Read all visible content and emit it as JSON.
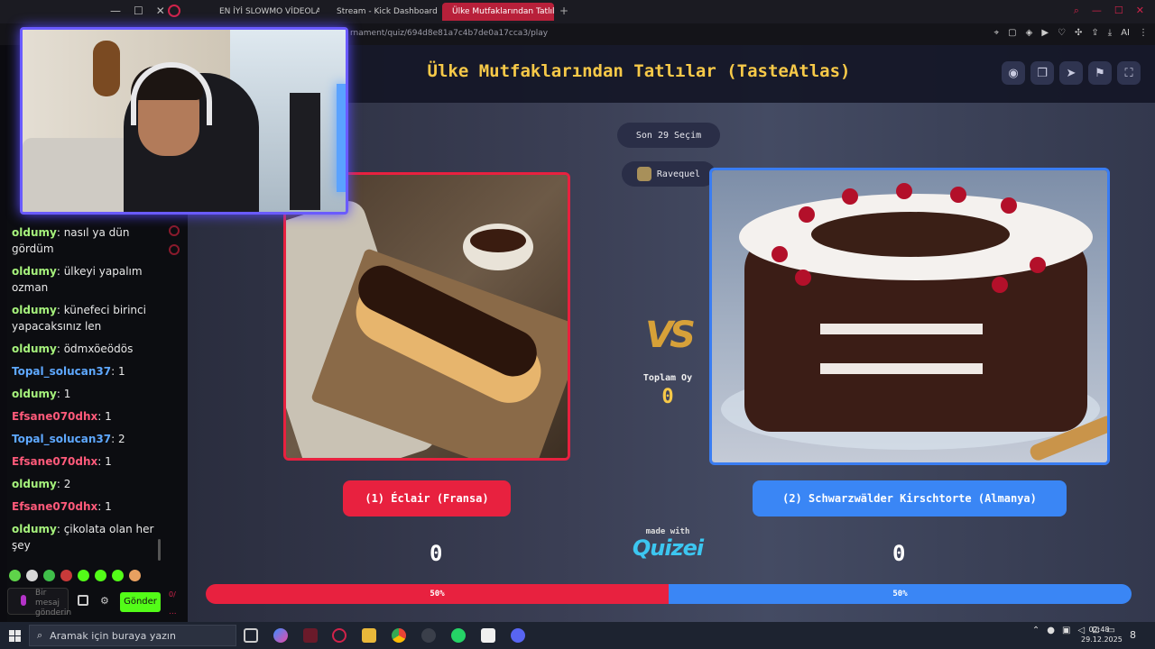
{
  "browser": {
    "tabs": [
      {
        "label": "EN İYİ SLOWMO VİDEOLA",
        "color": "#ff2a2a"
      },
      {
        "label": "Stream - Kick Dashboard",
        "color": "#53fc18"
      },
      {
        "label": "Ülke Mutfaklarından Tatlıla",
        "color": "#e8a33a",
        "active": true
      }
    ],
    "new_tab": "+",
    "url": "rnament/quiz/694d8e81a7c4b7de0a17cca3/play",
    "ai_label": "AI"
  },
  "chat": {
    "messages": [
      {
        "user": "oldumy",
        "text": " nasıl ya dün gördüm",
        "color": "#a6f27c"
      },
      {
        "user": "oldumy",
        "text": " ülkeyi yapalım ozman",
        "color": "#a6f27c"
      },
      {
        "user": "oldumy",
        "text": " künefeci birinci yapacaksınız len",
        "color": "#a6f27c"
      },
      {
        "user": "oldumy",
        "text": " ödmxöeödös",
        "color": "#a6f27c"
      },
      {
        "user": "Topal_solucan37",
        "text": " 1",
        "color": "#5ea8ff"
      },
      {
        "user": "oldumy",
        "text": " 1",
        "color": "#a6f27c"
      },
      {
        "user": "Efsane070dhx",
        "text": " 1",
        "color": "#ff5a7a"
      },
      {
        "user": "Topal_solucan37",
        "text": " 2",
        "color": "#5ea8ff"
      },
      {
        "user": "Efsane070dhx",
        "text": " 1",
        "color": "#ff5a7a"
      },
      {
        "user": "oldumy",
        "text": " 2",
        "color": "#a6f27c"
      },
      {
        "user": "Efsane070dhx",
        "text": " 1",
        "color": "#ff5a7a"
      },
      {
        "user": "oldumy",
        "text": " çikolata olan her şey",
        "color": "#a6f27c"
      }
    ],
    "input_placeholder": "Bir mesaj gönderin",
    "send_label": "Gönder",
    "count": "0/",
    "dots": "..."
  },
  "quiz": {
    "title": "Ülke Mutfaklarından Tatlılar (TasteAtlas)",
    "round_label": "Son 29 Seçim",
    "user_name": "Ravequel",
    "vs_label": "VS",
    "total_label": "Toplam Oy",
    "total_votes": "0",
    "left_choice": {
      "label": "(1) Éclair (Fransa)",
      "score": "0",
      "percent_label": "50%",
      "share": 0.5
    },
    "right_choice": {
      "label": "(2) Schwarzwälder Kirschtorte (Almanya)",
      "score": "0",
      "percent_label": "50%",
      "share": 0.5
    },
    "made_with": "made with",
    "brand": "Quizei",
    "colors": {
      "accent": "#f7c948",
      "left": "#e8213f",
      "right": "#3a86f5"
    }
  },
  "taskbar": {
    "search_placeholder": "Aramak için buraya yazın",
    "time": "02:48",
    "date": "29.12.2025",
    "notification_count": "8"
  }
}
